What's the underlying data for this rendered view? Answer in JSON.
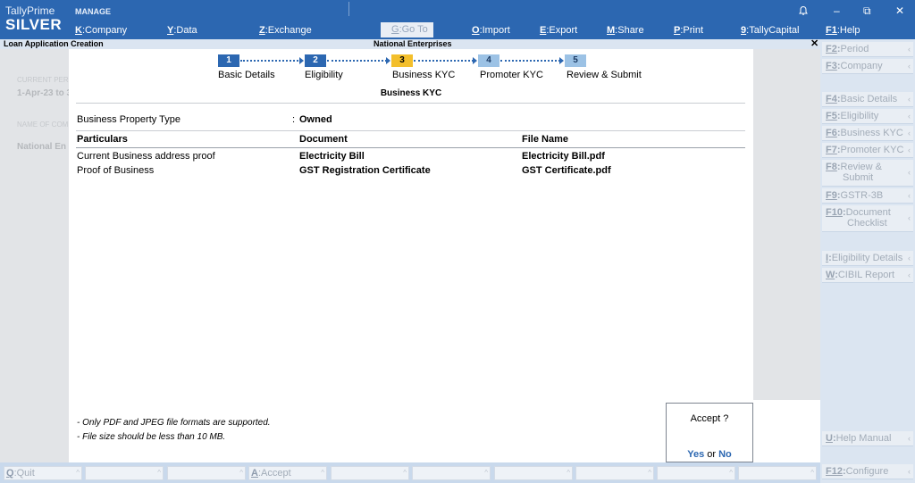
{
  "app": {
    "brand_top": "TallyPrime",
    "brand_bottom": "SILVER",
    "manage": "MANAGE"
  },
  "topmenu": [
    {
      "key": "K",
      "label": "Company"
    },
    {
      "key": "Y",
      "label": "Data"
    },
    {
      "key": "Z",
      "label": "Exchange"
    },
    {
      "key": "G",
      "label": "Go To"
    },
    {
      "key": "O",
      "label": "Import"
    },
    {
      "key": "E",
      "label": "Export"
    },
    {
      "key": "M",
      "label": "Share"
    },
    {
      "key": "P",
      "label": "Print"
    },
    {
      "key": "9",
      "label": "TallyCapital"
    },
    {
      "key": "F1",
      "label": "Help"
    }
  ],
  "window_controls": {
    "minimize": "–",
    "restore": "⧉",
    "close": "✕"
  },
  "title_strip": {
    "left": "Loan Application Creation",
    "center": "National Enterprises",
    "close": "✕"
  },
  "left_panel": {
    "current_period_label": "CURRENT PERI",
    "current_period_value": "1-Apr-23 to 3",
    "company_label": "NAME OF COM",
    "company_value": "National En"
  },
  "stepper": [
    {
      "num": "1",
      "label": "Basic Details",
      "state": "done"
    },
    {
      "num": "2",
      "label": "Eligibility",
      "state": "done"
    },
    {
      "num": "3",
      "label": "Business KYC",
      "state": "active"
    },
    {
      "num": "4",
      "label": "Promoter KYC",
      "state": "pending"
    },
    {
      "num": "5",
      "label": "Review & Submit",
      "state": "pending"
    }
  ],
  "section_title": "Business KYC",
  "property": {
    "label": "Business Property Type",
    "separator": ":",
    "value": "Owned"
  },
  "table": {
    "headers": [
      "Particulars",
      "Document",
      "File Name"
    ],
    "rows": [
      [
        "Current Business address proof",
        "Electricity Bill",
        "Electricity Bill.pdf"
      ],
      [
        "Proof of Business",
        "GST Registration Certificate",
        "GST Certificate.pdf"
      ]
    ]
  },
  "notes": [
    "- Only PDF and JPEG file formats are supported.",
    "- File size should be less than 10 MB."
  ],
  "accept_dialog": {
    "question": "Accept ?",
    "yes": "Yes",
    "or": "or",
    "no": "No"
  },
  "sidebar": [
    {
      "key": "F2",
      "label": "Period"
    },
    {
      "key": "F3",
      "label": "Company"
    },
    {
      "key": "F4",
      "label": "Basic Details"
    },
    {
      "key": "F5",
      "label": "Eligibility"
    },
    {
      "key": "F6",
      "label": "Business KYC"
    },
    {
      "key": "F7",
      "label": "Promoter KYC"
    },
    {
      "key": "F8",
      "label": "Review &",
      "label2": "Submit"
    },
    {
      "key": "F9",
      "label": "GSTR-3B"
    },
    {
      "key": "F10",
      "label": "Document",
      "label2": "Checklist"
    },
    {
      "key": "I",
      "label": "Eligibility Details"
    },
    {
      "key": "W",
      "label": "CIBIL Report"
    },
    {
      "key": "U",
      "label": "Help Manual"
    },
    {
      "key": "F12",
      "label": "Configure"
    }
  ],
  "bottom_bar": [
    {
      "key": "Q",
      "label": "Quit"
    },
    {
      "key": "A",
      "label": "Accept"
    }
  ]
}
